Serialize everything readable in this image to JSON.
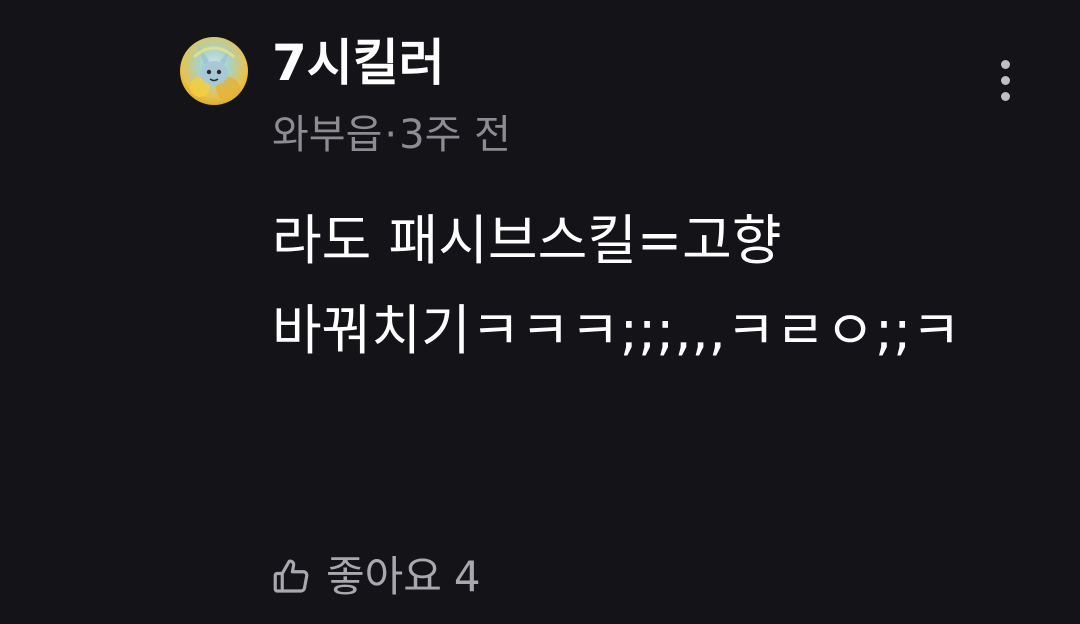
{
  "comment": {
    "author": "7시킬러",
    "handle": "와부읍",
    "separator": "·",
    "time": "3주 전",
    "text": "라도 패시브스킬=고향 바꿔치기ㅋㅋㅋ;;;,,,ㅋㄹㅇ;;ㅋ",
    "like_label": "좋아요",
    "like_count": "4",
    "avatar_icon": "character-avatar-icon",
    "more_icon": "more-vertical-icon",
    "like_icon": "thumbs-up-icon"
  },
  "colors": {
    "background": "#141418",
    "primary_text": "#ffffff",
    "secondary_text": "#8c8c92",
    "like_text": "#a8a8ae"
  }
}
